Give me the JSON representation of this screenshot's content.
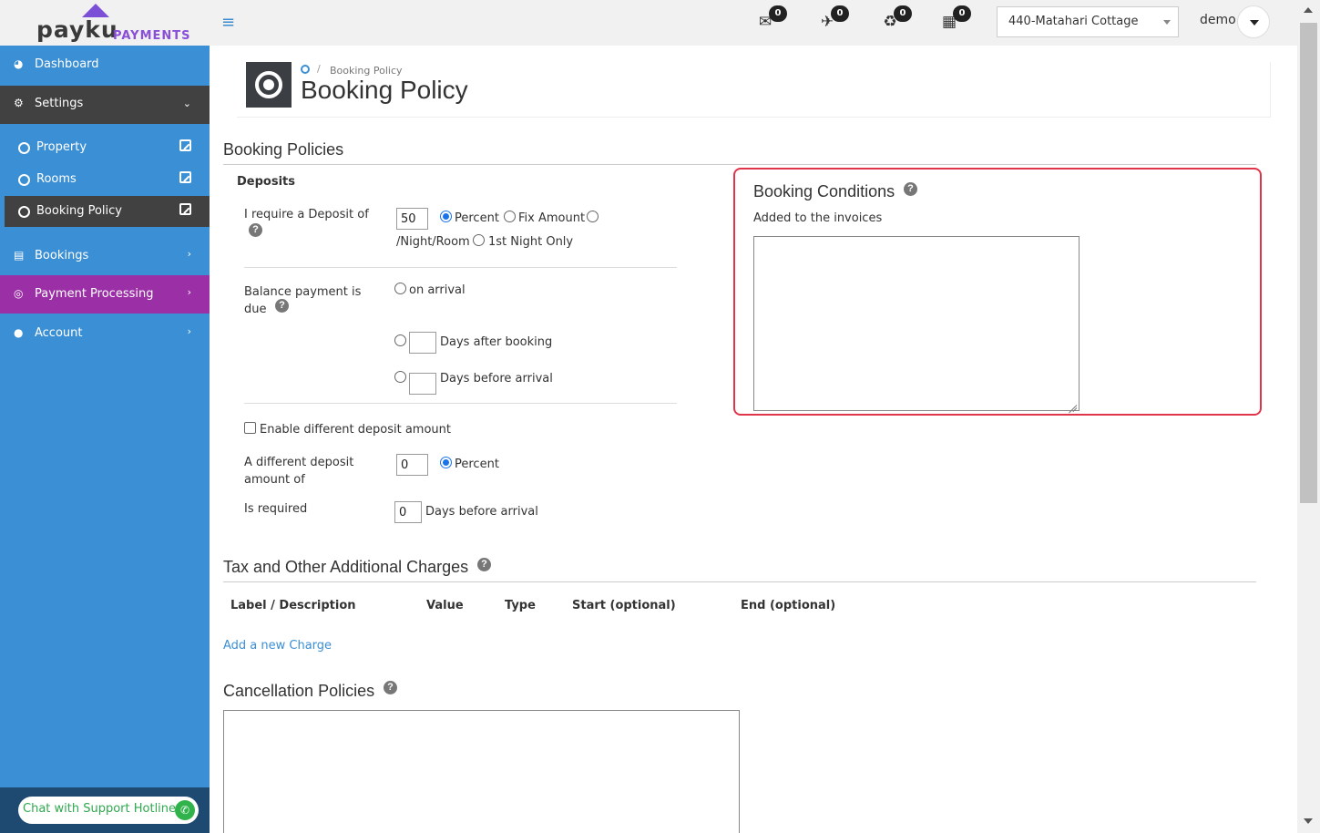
{
  "brand": {
    "logo_main": "payku",
    "logo_sub": "PAYMENTS"
  },
  "topbar": {
    "counters": [
      {
        "icon": "mail-icon",
        "count": "0"
      },
      {
        "icon": "checkin-icon",
        "count": "0"
      },
      {
        "icon": "checkout-icon",
        "count": "0"
      },
      {
        "icon": "calendar-icon",
        "count": "0"
      }
    ],
    "property": "440-Matahari Cottage",
    "user": "demo"
  },
  "sidebar": {
    "dashboard": "Dashboard",
    "settings": "Settings",
    "sub": [
      {
        "label": "Property"
      },
      {
        "label": "Rooms"
      },
      {
        "label": "Booking Policy"
      }
    ],
    "bookings": "Bookings",
    "payment": "Payment Processing",
    "account": "Account",
    "support": "Chat with Support Hotline"
  },
  "header": {
    "breadcrumb": "Booking Policy",
    "title": "Booking Policy"
  },
  "policies": {
    "title": "Booking Policies",
    "deposits_label": "Deposits",
    "require_label": "I require a Deposit of",
    "deposit_value": "50",
    "opt_percent": "Percent",
    "opt_fix": "Fix Amount",
    "opt_night": "/Night/Room",
    "opt_first": "1st Night Only",
    "balance_label": "Balance payment is due",
    "on_arrival": "on arrival",
    "days_after": "Days after booking",
    "days_before": "Days before arrival",
    "enable_diff": "Enable different deposit amount",
    "diff_label": "A different deposit amount of",
    "diff_value": "0",
    "diff_percent": "Percent",
    "required_label": "Is required",
    "required_value": "0",
    "required_days": "Days before arrival"
  },
  "conditions": {
    "title": "Booking Conditions",
    "subtitle": "Added to the invoices"
  },
  "tax": {
    "title": "Tax and Other Additional Charges",
    "headers": [
      "Label / Description",
      "Value",
      "Type",
      "Start (optional)",
      "End (optional)"
    ],
    "add_link": "Add a new Charge"
  },
  "cancellation": {
    "title": "Cancellation Policies"
  }
}
